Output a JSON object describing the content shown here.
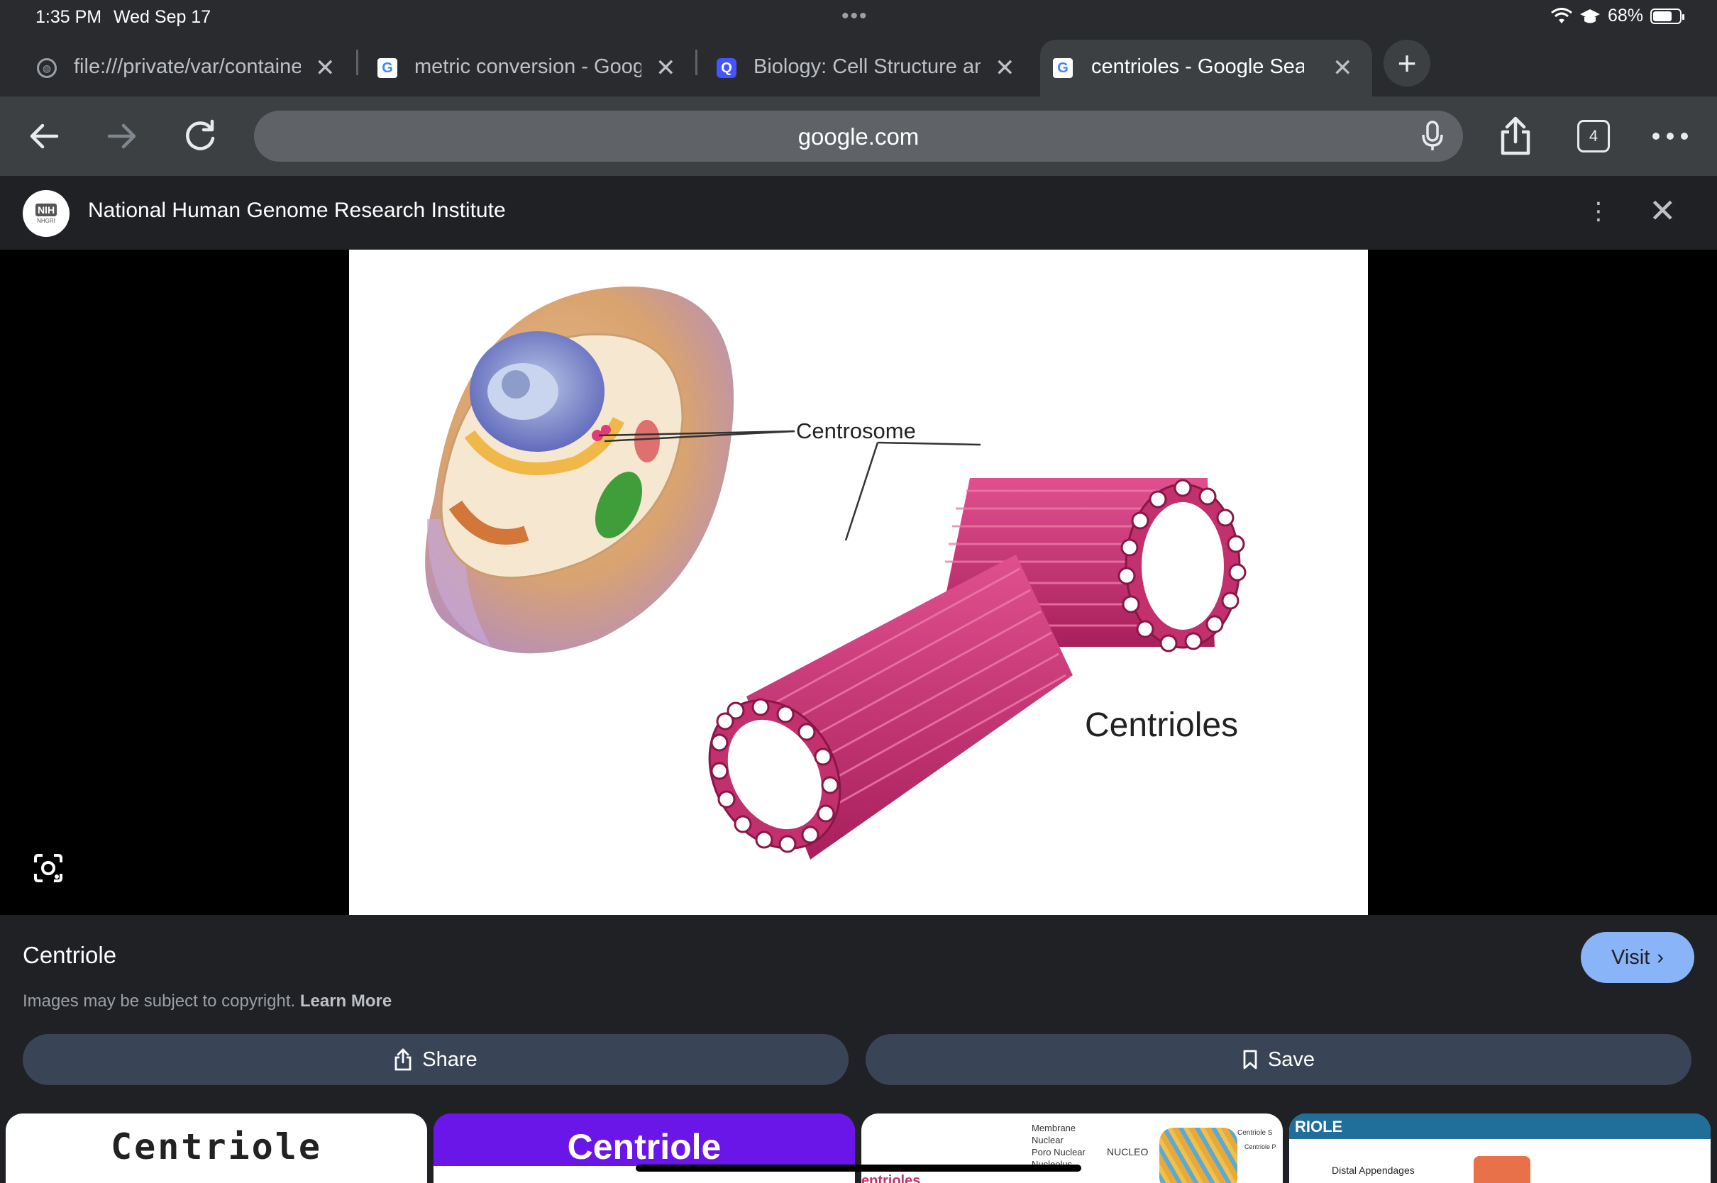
{
  "status_bar": {
    "time": "1:35 PM",
    "date": "Wed Sep 17",
    "battery": "68%",
    "battery_level": 0.68
  },
  "tabs": [
    {
      "title": "file:///private/var/containers",
      "favicon": "globe-icon"
    },
    {
      "title": "metric conversion - Google Search",
      "favicon": "google-icon"
    },
    {
      "title": "Biology: Cell Structure and Function",
      "favicon": "quizlet-icon"
    },
    {
      "title": "centrioles - Google Search",
      "favicon": "google-icon",
      "active": true
    }
  ],
  "toolbar": {
    "url": "google.com",
    "tab_count": "4"
  },
  "source": {
    "name": "National Human Genome Research Institute",
    "logo_text": "NIH",
    "logo_sub": "NHGRI"
  },
  "figure": {
    "label_centrosome": "Centrosome",
    "label_centrioles": "Centrioles"
  },
  "panel": {
    "title": "Centriole",
    "visit_label": "Visit",
    "copyright_text": "Images may be subject to copyright.",
    "learn_more": "Learn More",
    "share_label": "Share",
    "save_label": "Save"
  },
  "thumbnails": [
    {
      "caption": "Centriole"
    },
    {
      "caption": "Centriole"
    },
    {
      "labels": [
        "Membrane",
        "Nuclear",
        "Poro Nuclear",
        "NUCLEO",
        "Nucleolus",
        "entrioles",
        "Centriole S",
        "Centriole P"
      ]
    },
    {
      "caption": "RIOLE",
      "label": "Distal Appendages"
    }
  ],
  "colors": {
    "accent": "#8ab4f8",
    "button_bg": "#394457",
    "centriole": "#c2306e"
  }
}
